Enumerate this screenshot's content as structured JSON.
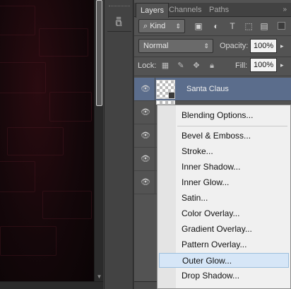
{
  "tabs": [
    "Layers",
    "Channels",
    "Paths"
  ],
  "filter": {
    "kind_label": "Kind"
  },
  "blend": {
    "mode": "Normal",
    "opacity_label": "Opacity:",
    "opacity_value": "100%"
  },
  "lock": {
    "label": "Lock:",
    "fill_label": "Fill:",
    "fill_value": "100%"
  },
  "layers": [
    {
      "name": "Santa Claus"
    }
  ],
  "context_menu": {
    "items": [
      "Blending Options...",
      "Bevel & Emboss...",
      "Stroke...",
      "Inner Shadow...",
      "Inner Glow...",
      "Satin...",
      "Color Overlay...",
      "Gradient Overlay...",
      "Pattern Overlay...",
      "Outer Glow...",
      "Drop Shadow..."
    ],
    "hovered": "Outer Glow..."
  },
  "colors": {
    "panel": "#535353",
    "selected_layer": "#5b6d8c",
    "menu_hover": "#d6e6f7"
  }
}
